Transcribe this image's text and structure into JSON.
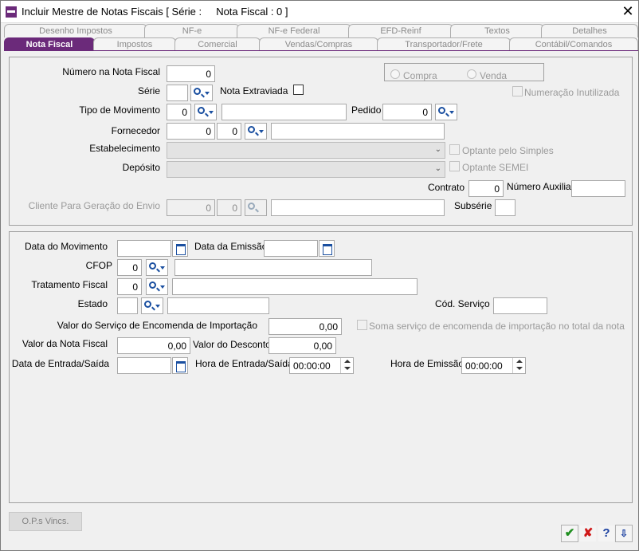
{
  "window": {
    "title": "Incluir Mestre de Notas Fiscais [ Série :     Nota Fiscal : 0 ]"
  },
  "tabs_row1": [
    "Desenho Impostos",
    "NF-e",
    "NF-e Federal",
    "EFD-Reinf",
    "Textos",
    "Detalhes"
  ],
  "tabs_row2": [
    "Nota Fiscal",
    "Impostos",
    "Comercial",
    "Vendas/Compras",
    "Transportador/Frete",
    "Contábil/Comandos"
  ],
  "header": {
    "numero_label": "Número na Nota Fiscal",
    "numero_value": "0",
    "serie_label": "Série",
    "serie_value": "",
    "extraviada_label": "Nota Extraviada",
    "compra_label": "Compra",
    "venda_label": "Venda",
    "inutilizada_label": "Numeração Inutilizada",
    "tipo_mov_label": "Tipo de Movimento",
    "tipo_mov_value": "0",
    "tipo_mov_desc": "",
    "pedido_label": "Pedido",
    "pedido_value": "0",
    "fornecedor_label": "Fornecedor",
    "fornecedor_value1": "0",
    "fornecedor_value2": "0",
    "fornecedor_desc": "",
    "estab_label": "Estabelecimento",
    "simples_label": "Optante pelo Simples",
    "deposito_label": "Depósito",
    "semei_label": "Optante SEMEI",
    "contrato_label": "Contrato",
    "contrato_value": "0",
    "num_aux_label": "Número Auxiliar",
    "num_aux_value": "",
    "cliente_envio_label": "Cliente Para Geração do Envio",
    "cliente_envio_value1": "0",
    "cliente_envio_value2": "0",
    "cliente_envio_desc": "",
    "subserie_label": "Subsérie",
    "subserie_value": ""
  },
  "details": {
    "data_mov_label": "Data do Movimento",
    "data_mov_value": "",
    "data_emissao_label": "Data da Emissão",
    "data_emissao_value": "",
    "cfop_label": "CFOP",
    "cfop_value": "0",
    "cfop_desc": "",
    "trat_fiscal_label": "Tratamento Fiscal",
    "trat_fiscal_value": "0",
    "trat_fiscal_desc": "",
    "estado_label": "Estado",
    "estado_value": "",
    "estado_desc": "",
    "cod_servico_label": "Cód. Serviço",
    "cod_servico_value": "",
    "valor_servico_label": "Valor do Serviço de Encomenda de Importação",
    "valor_servico_value": "0,00",
    "soma_servico_label": "Soma serviço de encomenda de importação no total da nota",
    "valor_nota_label": "Valor da Nota Fiscal",
    "valor_nota_value": "0,00",
    "valor_desconto_label": "Valor do Desconto",
    "valor_desconto_value": "0,00",
    "data_entrada_label": "Data de Entrada/Saída",
    "data_entrada_value": "",
    "hora_entrada_label": "Hora de Entrada/Saída",
    "hora_entrada_value": "00:00:00",
    "hora_emissao_label": "Hora de Emissão",
    "hora_emissao_value": "00:00:00"
  },
  "footer": {
    "ops_button": "O.P.s Vincs.",
    "confirm_icon": "check-icon",
    "cancel_icon": "cancel-x-icon",
    "help_label": "?",
    "exit_icon": "exit-icon"
  }
}
